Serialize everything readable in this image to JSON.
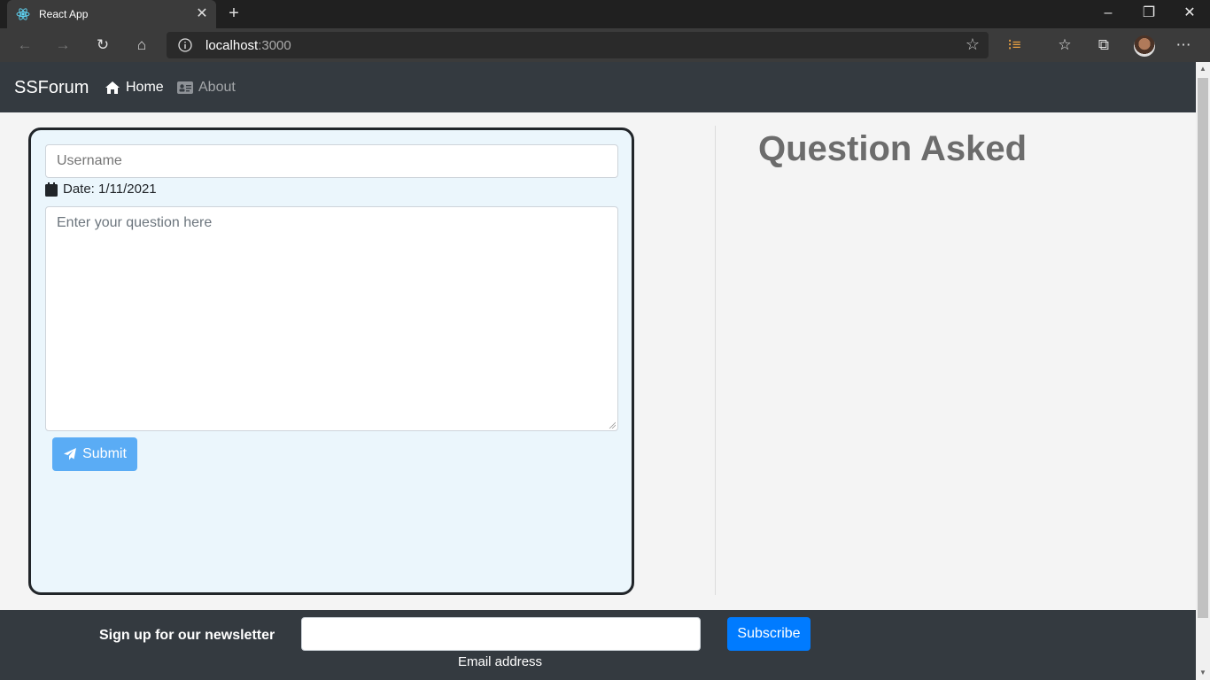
{
  "browser": {
    "tab_title": "React App",
    "url_host": "localhost",
    "url_port": ":3000"
  },
  "nav": {
    "brand": "SSForum",
    "home_label": "Home",
    "about_label": "About"
  },
  "form": {
    "username_placeholder": "Username",
    "date_text": "Date: 1/11/2021",
    "question_placeholder": "Enter your question here",
    "submit_label": "Submit"
  },
  "main": {
    "heading": "Question Asked"
  },
  "footer": {
    "newsletter_label": "Sign up for our newsletter",
    "email_help": "Email address",
    "subscribe_label": "Subscribe"
  },
  "colors": {
    "navbar_bg": "#343a40",
    "card_bg": "#ebf6fc",
    "submit_bg": "#5aacf5",
    "subscribe_bg": "#007bff"
  }
}
